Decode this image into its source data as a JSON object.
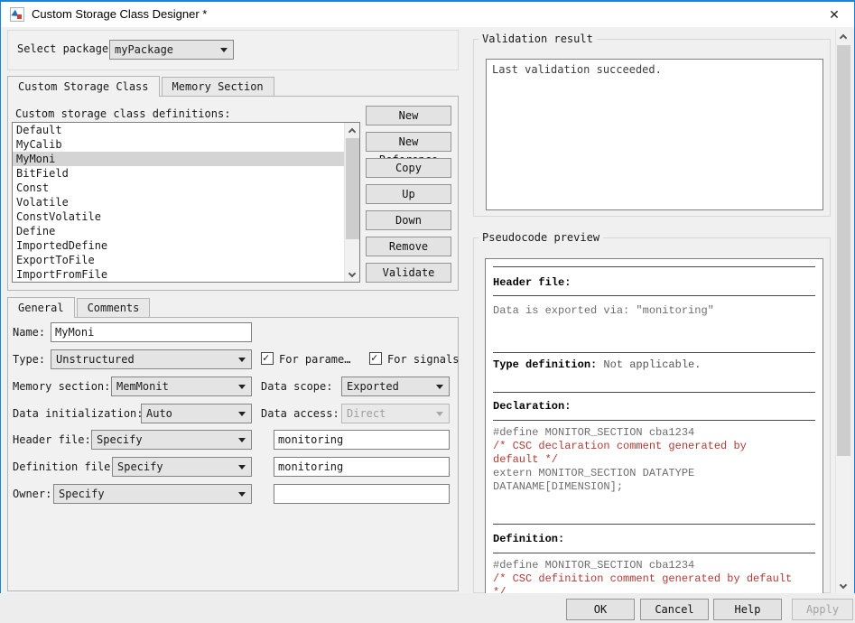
{
  "window": {
    "title": "Custom Storage Class Designer *"
  },
  "titlebar_icons": {
    "close": "✕"
  },
  "package": {
    "label": "Select package:",
    "value": "myPackage"
  },
  "tabs_main": [
    "Custom Storage Class",
    "Memory Section"
  ],
  "csc_list": {
    "label": "Custom storage class definitions:",
    "items": [
      "Default",
      "MyCalib",
      "MyMoni",
      "BitField",
      "Const",
      "Volatile",
      "ConstVolatile",
      "Define",
      "ImportedDefine",
      "ExportToFile",
      "ImportFromFile"
    ],
    "selected": "MyMoni"
  },
  "actions": [
    "New",
    "New Reference",
    "Copy",
    "Up",
    "Down",
    "Remove",
    "Validate"
  ],
  "tabs_detail": [
    "General",
    "Comments"
  ],
  "form": {
    "name_label": "Name:",
    "name_value": "MyMoni",
    "type_label": "Type:",
    "type_value": "Unstructured",
    "for_parameters_label": "For parame…",
    "for_parameters_checked": "✓",
    "for_signals_label": "For signals",
    "for_signals_checked": "✓",
    "memory_section_label": "Memory section:",
    "memory_section_value": "MemMonit",
    "data_scope_label": "Data scope:",
    "data_scope_value": "Exported",
    "data_initialization_label": "Data initialization:",
    "data_initialization_value": "Auto",
    "data_access_label": "Data access:",
    "data_access_value": "Direct",
    "header_file_label": "Header file:",
    "header_file_mode": "Specify",
    "header_file_value": "monitoring",
    "definition_file_label": "Definition file:",
    "definition_file_mode": "Specify",
    "definition_file_value": "monitoring",
    "owner_label": "Owner:",
    "owner_mode": "Specify",
    "owner_value": ""
  },
  "validation": {
    "group_label": "Validation result",
    "message": "Last validation succeeded."
  },
  "pseudocode": {
    "group_label": "Pseudocode preview",
    "header_file_heading": "Header file:",
    "header_file_text": "Data is exported via: \"monitoring\"",
    "type_definition_heading": "Type definition:",
    "type_definition_text": " Not applicable.",
    "declaration_heading": "Declaration:",
    "decl_code_1": "#define MONITOR_SECTION cba1234",
    "decl_comment_1": "/* CSC declaration comment generated by",
    "decl_comment_2": "default */",
    "decl_code_2": "extern MONITOR_SECTION DATATYPE",
    "decl_code_3": "DATANAME[DIMENSION];",
    "definition_heading": "Definition:",
    "def_code_1": "#define MONITOR_SECTION cba1234",
    "def_comment_1": "/* CSC definition comment generated by default",
    "def_comment_2": "*/"
  },
  "footer": {
    "ok": "OK",
    "cancel": "Cancel",
    "help": "Help",
    "apply": "Apply"
  },
  "colors": {
    "accent_blue": "#1884d9",
    "code_gray": "#6e6e6e",
    "comment_red": "#b23b36",
    "selection_gray": "#d4d4d4"
  }
}
